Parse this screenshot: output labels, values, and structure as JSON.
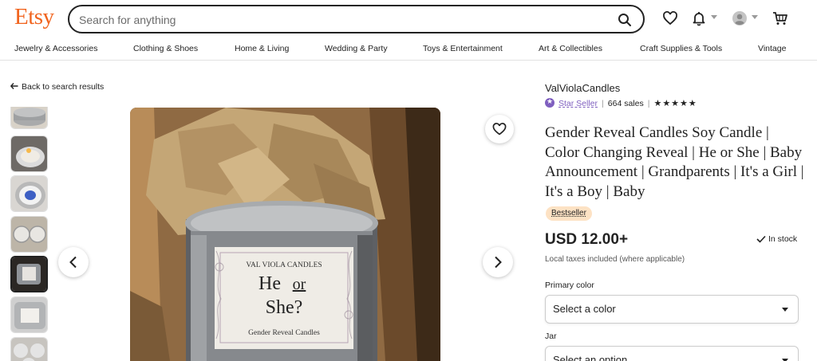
{
  "brand": {
    "logo": "Etsy",
    "color": "#f1641e"
  },
  "search": {
    "placeholder": "Search for anything"
  },
  "header_icons": [
    "search-icon",
    "heart-icon",
    "bell-icon",
    "account-icon",
    "cart-icon"
  ],
  "categories": [
    "Jewelry & Accessories",
    "Clothing & Shoes",
    "Home & Living",
    "Wedding & Party",
    "Toys & Entertainment",
    "Art & Collectibles",
    "Craft Supplies & Tools",
    "Vintage"
  ],
  "back_link": "Back to search results",
  "gallery": {
    "image_label_brand": "VAL VIOLA CANDLES",
    "image_label_he": "He",
    "image_label_or": "or",
    "image_label_she": "She?",
    "image_label_sub": "Gender Reveal Candles",
    "active_thumb_index": 4
  },
  "listing": {
    "shop_name": "ValViolaCandles",
    "star_seller": "Star Seller",
    "sales": "664 sales",
    "rating_stars": "★★★★★",
    "title": "Gender Reveal Candles Soy Candle | Color Changing Reveal | He or She | Baby Announcement | Grandparents | It's a Girl | It's a Boy | Baby",
    "badge": "Bestseller",
    "price": "USD 12.00+",
    "stock": "In stock",
    "taxes": "Local taxes included (where applicable)",
    "option1_label": "Primary color",
    "option1_value": "Select a color",
    "option2_label": "Jar",
    "option2_value": "Select an option"
  }
}
